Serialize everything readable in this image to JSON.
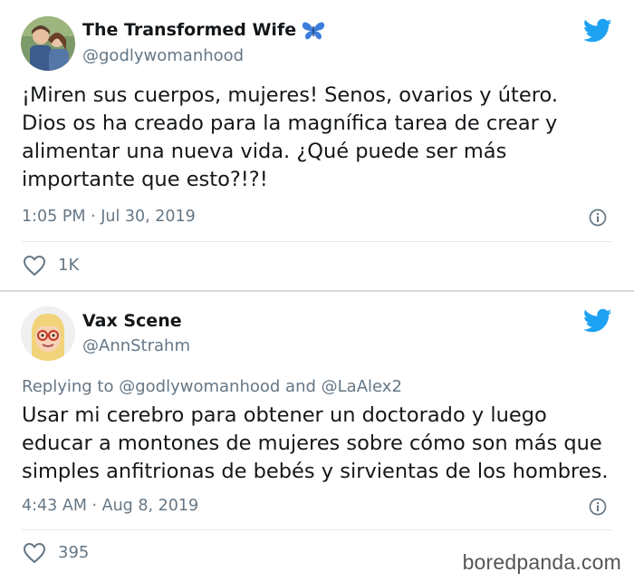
{
  "tweets": [
    {
      "author_name": "The Transformed Wife",
      "author_badge_icon": "butterfly-icon",
      "handle": "@godlywomanhood",
      "text_lines": [
        "¡Miren sus cuerpos, mujeres! Senos, ovarios y útero.",
        "Dios os ha creado para la magnífica tarea de crear y",
        "alimentar una nueva vida. ¿Qué puede ser más",
        "importante que esto?!?!"
      ],
      "timestamp": "1:05 PM · Jul 30, 2019",
      "likes": "1K"
    },
    {
      "author_name": "Vax Scene",
      "handle": "@AnnStrahm",
      "replying_prefix": "Replying to",
      "replying_to_1": "@godlywomanhood",
      "replying_and": "and",
      "replying_to_2": "@LaAlex2",
      "text_lines": [
        "Usar mi cerebro para obtener un doctorado y luego",
        "educar a montones de mujeres sobre cómo son más que",
        "simples anfitrionas de bebés y sirvientas de los hombres."
      ],
      "timestamp": "4:43 AM · Aug 8, 2019",
      "likes": "395"
    }
  ],
  "watermark": "boredpanda.com",
  "colors": {
    "twitter_blue": "#1da1f2",
    "secondary_text": "#657786",
    "separator": "#d6d9dc",
    "butterfly": "#3d7ddb"
  }
}
